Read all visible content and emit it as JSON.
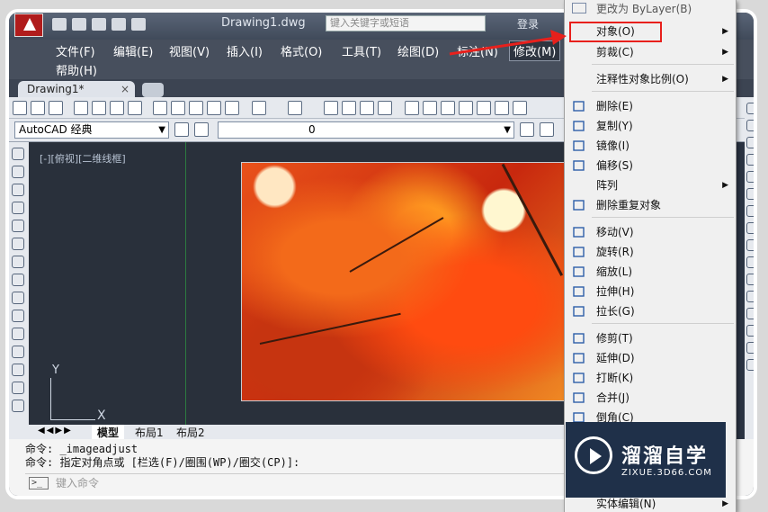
{
  "title_bar": {
    "document_title": "Drawing1.dwg",
    "search_placeholder": "键入关键字或短语",
    "login_label": "登录"
  },
  "menubar": {
    "items": [
      "文件(F)",
      "编辑(E)",
      "视图(V)",
      "插入(I)",
      "格式(O)",
      "工具(T)",
      "绘图(D)",
      "标注(N)",
      "修改(M)"
    ],
    "help": "帮助(H)",
    "active_item": "修改(M)"
  },
  "doc_tab": {
    "label": "Drawing1*",
    "close": "×"
  },
  "workspace": {
    "label": "AutoCAD 经典"
  },
  "layer": {
    "label": "0"
  },
  "viewport": {
    "label": "[-][俯视][二维线框]",
    "ucs_x": "X",
    "ucs_y": "Y"
  },
  "layout_tabs": {
    "nav": "◀◀▶▶",
    "model": "模型",
    "layout1": "布局1",
    "layout2": "布局2"
  },
  "command_line": {
    "history": [
      "命令: _imageadjust",
      "命令: 指定对角点或 [栏选(F)/圈围(WP)/圈交(CP)]:"
    ],
    "input_placeholder": "键入命令"
  },
  "context_menu": {
    "top_partial": "更改为 ByLayer(B)",
    "items": [
      {
        "label": "对象(O)",
        "submenu": true
      },
      {
        "label": "剪裁(C)",
        "submenu": true
      },
      {
        "label": "注释性对象比例(O)",
        "submenu": true
      },
      {
        "label": "删除(E)",
        "submenu": false
      },
      {
        "label": "复制(Y)",
        "submenu": false
      },
      {
        "label": "镜像(I)",
        "submenu": false
      },
      {
        "label": "偏移(S)",
        "submenu": false
      },
      {
        "label": "阵列",
        "submenu": true
      },
      {
        "label": "删除重复对象",
        "submenu": false
      },
      {
        "label": "移动(V)",
        "submenu": false
      },
      {
        "label": "旋转(R)",
        "submenu": false
      },
      {
        "label": "缩放(L)",
        "submenu": false
      },
      {
        "label": "拉伸(H)",
        "submenu": false
      },
      {
        "label": "拉长(G)",
        "submenu": false
      },
      {
        "label": "修剪(T)",
        "submenu": false
      },
      {
        "label": "延伸(D)",
        "submenu": false
      },
      {
        "label": "打断(K)",
        "submenu": false
      },
      {
        "label": "合并(J)",
        "submenu": false
      },
      {
        "label": "倒角(C)",
        "submenu": false
      },
      {
        "label": "实体编辑(N)",
        "submenu": true
      }
    ],
    "highlighted": "对象(O)",
    "highlight_color": "#e8201c"
  },
  "watermark": {
    "title": "溜溜自学",
    "url": "ZIXUE.3D66.COM"
  }
}
